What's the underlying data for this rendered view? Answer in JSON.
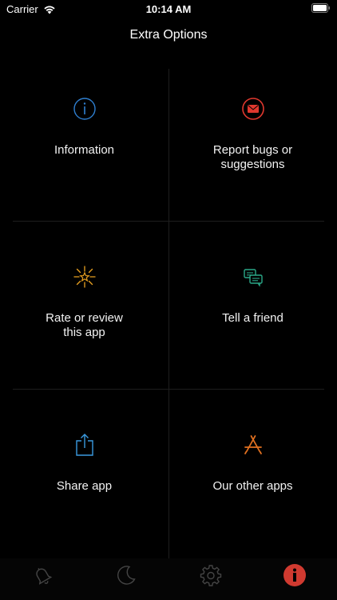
{
  "status_bar": {
    "carrier": "Carrier",
    "time": "10:14 AM"
  },
  "nav": {
    "title": "Extra Options"
  },
  "options": [
    {
      "label": "Information",
      "icon": "info-icon",
      "color": "#2f7fd0"
    },
    {
      "label": "Report bugs or\nsuggestions",
      "icon": "mail-icon",
      "color": "#e0382e"
    },
    {
      "label": "Rate or review\nthis app",
      "icon": "sparkle-star-icon",
      "color": "#e8a020"
    },
    {
      "label": "Tell a friend",
      "icon": "chat-bubbles-icon",
      "color": "#2aa888"
    },
    {
      "label": "Share app",
      "icon": "share-icon",
      "color": "#3a9ae0"
    },
    {
      "label": "Our other apps",
      "icon": "app-store-icon",
      "color": "#e07020"
    }
  ],
  "tabs": [
    {
      "icon": "bell-icon",
      "selected": false
    },
    {
      "icon": "moon-icon",
      "selected": false
    },
    {
      "icon": "gear-icon",
      "selected": false
    },
    {
      "icon": "info-icon",
      "selected": true,
      "color": "#d03a30"
    }
  ]
}
